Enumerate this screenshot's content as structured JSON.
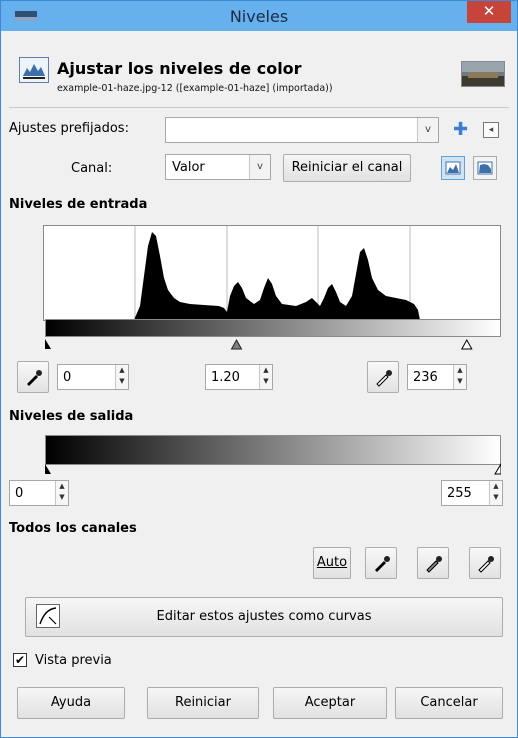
{
  "window": {
    "title": "Niveles",
    "close_glyph": "✕"
  },
  "header": {
    "title": "Ajustar los niveles de color",
    "subtitle": "example-01-haze.jpg-12 ([example-01-haze] (importada))"
  },
  "presets": {
    "label": "Ajustes prefijados:",
    "value": "",
    "add_glyph": "✚",
    "menu_glyph": "◂"
  },
  "channel": {
    "label": "Canal:",
    "value": "Valor",
    "reset_label": "Reiniciar el canal"
  },
  "input_levels": {
    "title": "Niveles de entrada",
    "low": "0",
    "gamma": "1.20",
    "high": "236",
    "low_fraction": 0.0,
    "gamma_fraction": 0.42,
    "high_fraction": 0.925
  },
  "output_levels": {
    "title": "Niveles de salida",
    "low": "0",
    "high": "255"
  },
  "all_channels": {
    "title": "Todos los canales",
    "auto_label": "Auto"
  },
  "curves_button": {
    "label": "Editar estos ajustes como curvas"
  },
  "preview": {
    "label": "Vista previa",
    "checked": true
  },
  "footer": {
    "help": "Ayuda",
    "reset": "Reiniciar",
    "ok": "Aceptar",
    "cancel": "Cancelar"
  },
  "glyphs": {
    "check": "✔",
    "dropdown": "v",
    "spin_up": "▲",
    "spin_down": "▼"
  },
  "colors": {
    "titlebar": "#66b0ee",
    "close": "#c7443a",
    "accent": "#3a8ad8"
  }
}
